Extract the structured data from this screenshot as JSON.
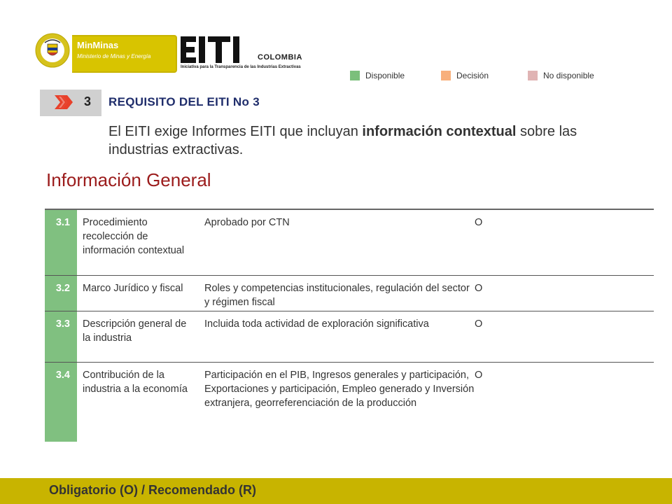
{
  "colors": {
    "disponible": "#7bbf7b",
    "decision": "#f8b07c",
    "no_disponible": "#e0b4b4",
    "number_cell": "#80c080",
    "footer_bar": "#c8b400",
    "section_title": "#9b1b1b",
    "requirement_title": "#1f2d6b"
  },
  "header": {
    "minminas_title": "MinMinas",
    "minminas_subtitle": "Ministerio de Minas y Energía",
    "eiti_logo_text": "EITI",
    "eiti_country": "COLOMBIA",
    "eiti_tagline": "Iniciativa para la Transparencia de las Industrias Extractivas",
    "seal_icon": "coat-of-arms-icon"
  },
  "legend": [
    {
      "label": "Disponible"
    },
    {
      "label": "Decisión"
    },
    {
      "label": "No disponible"
    }
  ],
  "requirement": {
    "number": "3",
    "title": "REQUISITO DEL EITI No 3",
    "description_pre": "El EITI exige Informes EITI que incluyan ",
    "description_bold": "información contextual",
    "description_post": " sobre las industrias extractivas.",
    "icon": "double-chevron-right-icon"
  },
  "section_title": "Información General",
  "table_rows": [
    {
      "num": "3.1",
      "name": "Procedimiento recolección de información contextual",
      "desc": "Aprobado  por CTN",
      "oblig": "O"
    },
    {
      "num": "3.2",
      "name": "Marco Jurídico y fiscal",
      "desc": "Roles y competencias institucionales, regulación del sector y régimen fiscal",
      "oblig": "O"
    },
    {
      "num": "3.3",
      "name": "Descripción general de la industria",
      "desc": "Incluida toda actividad de exploración significativa",
      "oblig": "O"
    },
    {
      "num": "3.4",
      "name": "Contribución  de la industria a la economía",
      "desc": "Participación en el PIB, Ingresos generales y participación, Exportaciones  y participación, Empleo generado y Inversión extranjera, georreferenciación  de la producción",
      "oblig": "O"
    }
  ],
  "footer": {
    "text": "Obligatorio (O) / Recomendado (R)"
  }
}
